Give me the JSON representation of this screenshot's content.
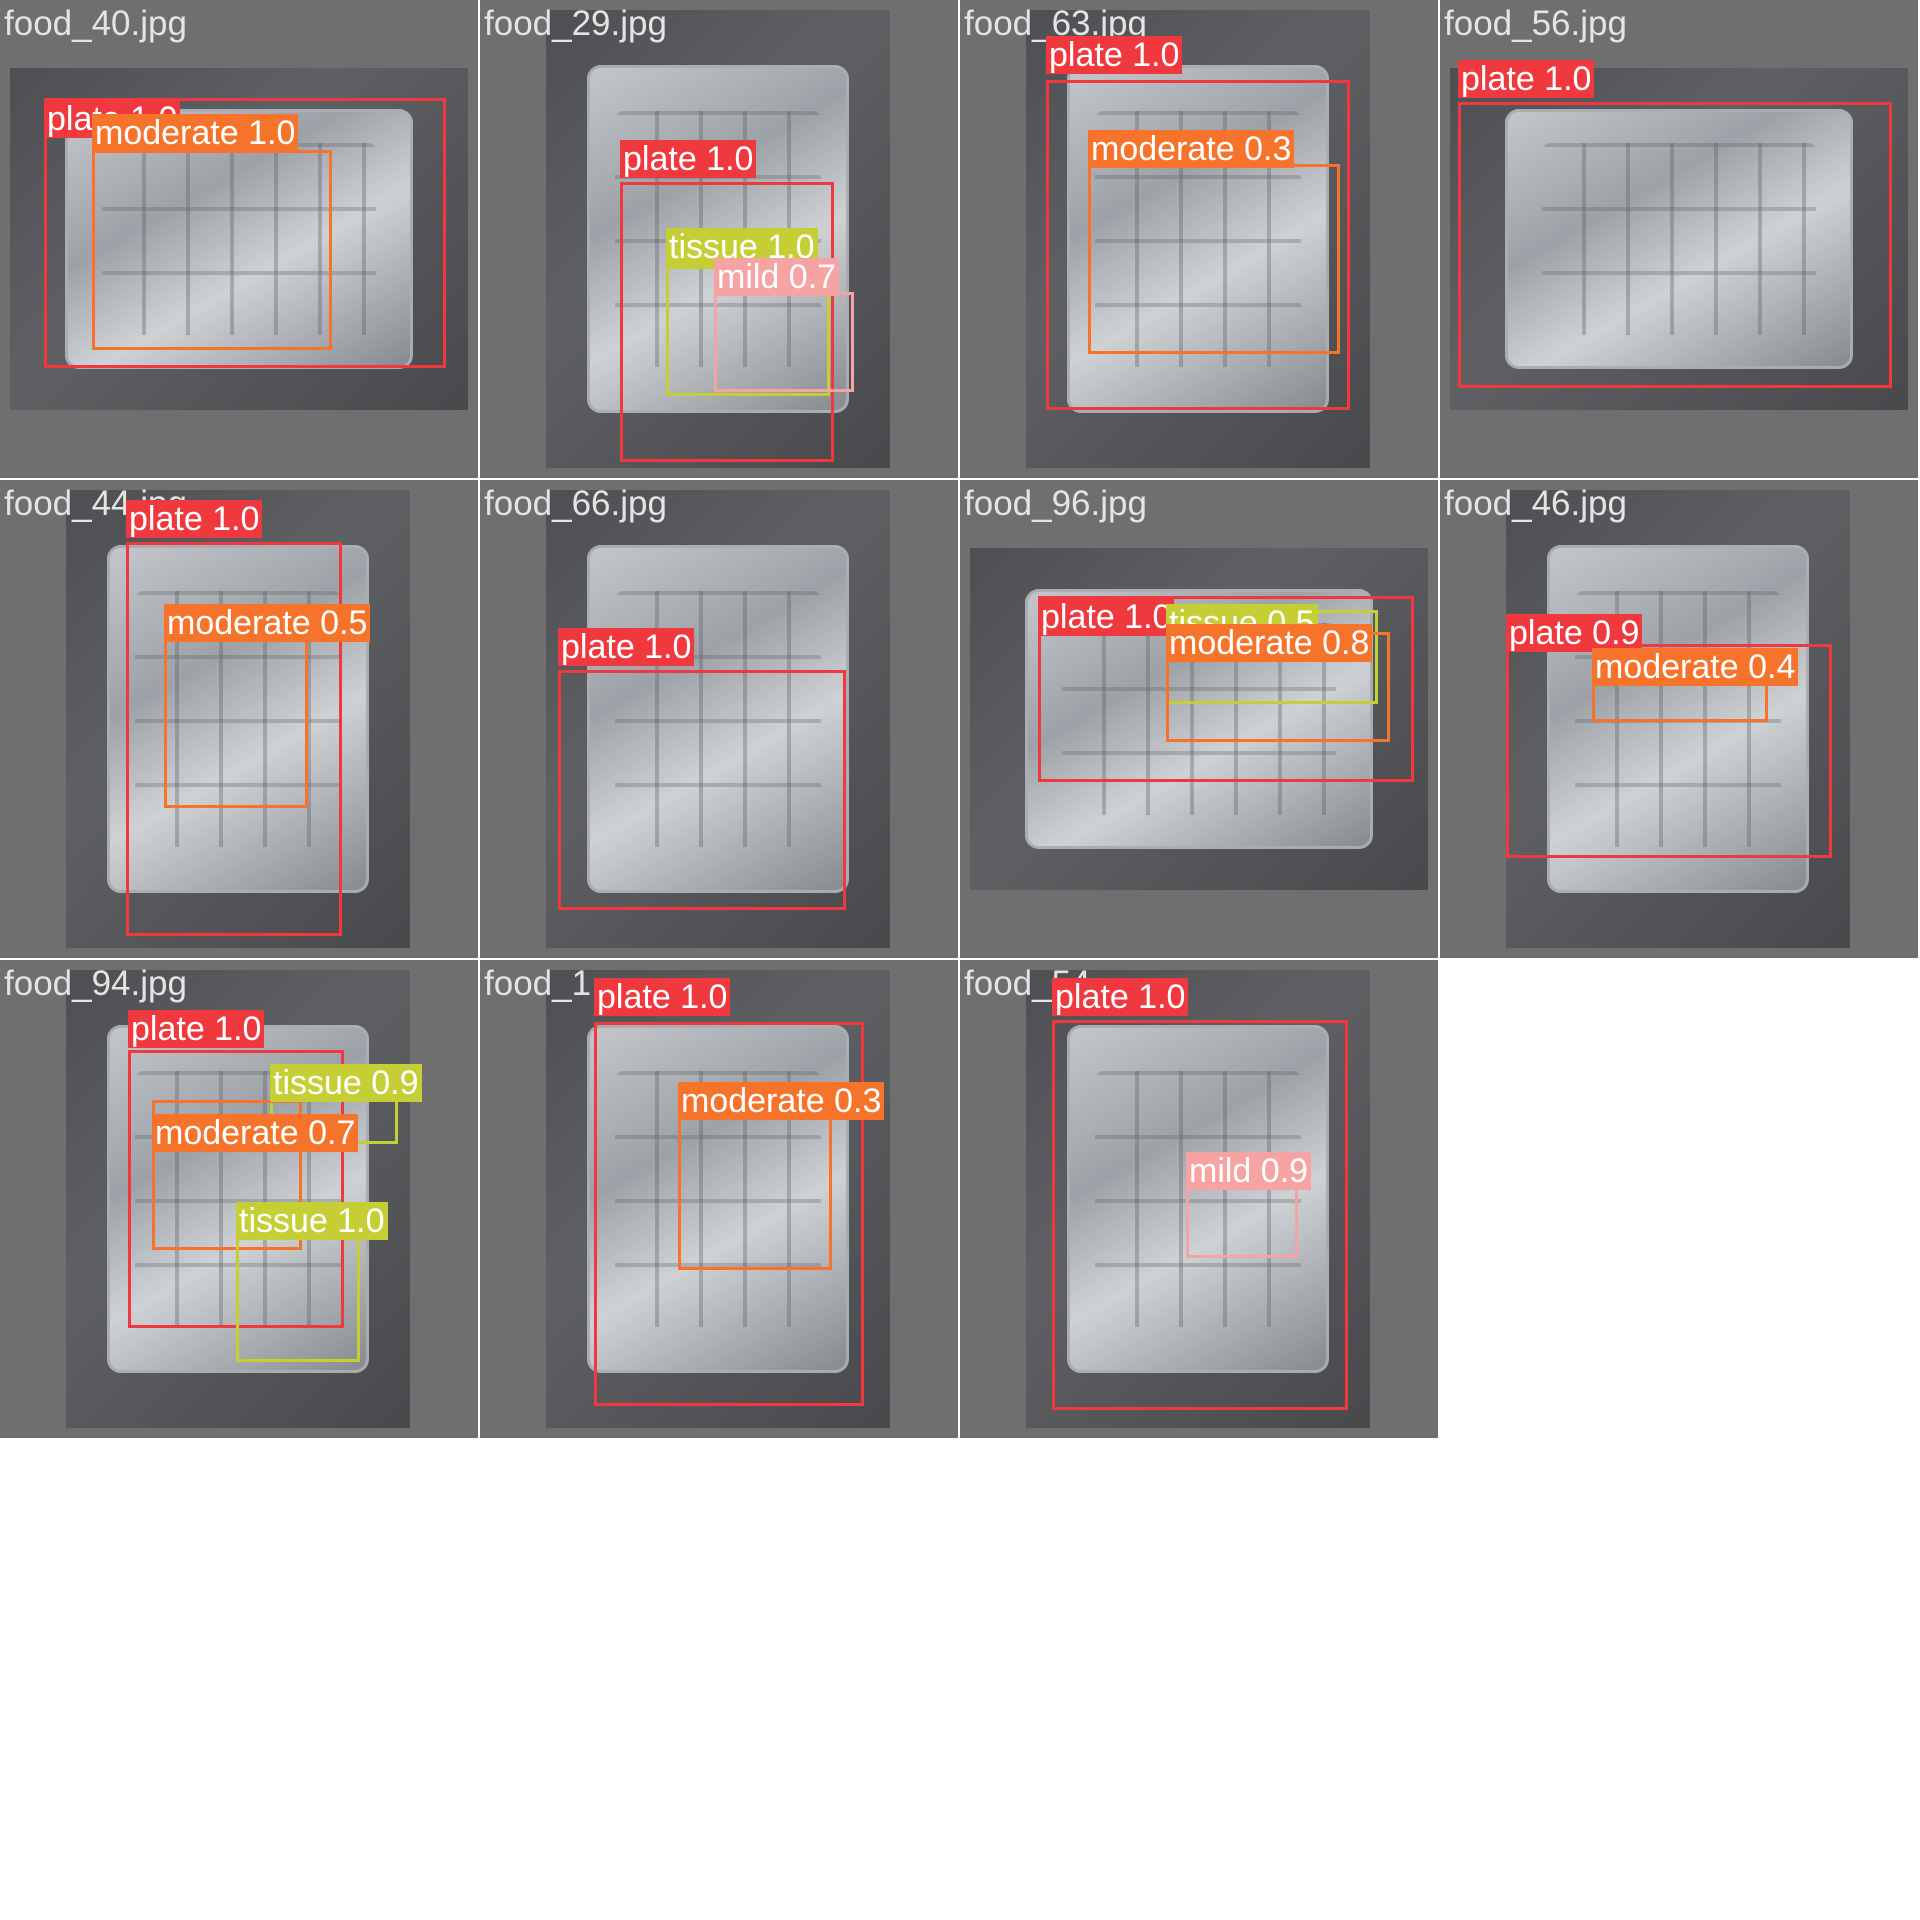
{
  "colors": {
    "plate": "#f0393e",
    "moderate": "#f5732a",
    "tissue": "#c5cf35",
    "mild": "#f5a3a3",
    "tile_background": "#6f6f6f"
  },
  "tiles": [
    {
      "filename": "food_40.jpg",
      "detections": [
        {
          "label": "plate 1.0",
          "class": "plate"
        },
        {
          "label": "moderate 1.0",
          "class": "moderate"
        }
      ]
    },
    {
      "filename": "food_29.jpg",
      "detections": [
        {
          "label": "plate 1.0",
          "class": "plate"
        },
        {
          "label": "tissue 1.0",
          "class": "tissue"
        },
        {
          "label": "mild 0.7",
          "class": "mild"
        }
      ]
    },
    {
      "filename": "food_63.jpg",
      "detections": [
        {
          "label": "plate 1.0",
          "class": "plate"
        },
        {
          "label": "moderate 0.3",
          "class": "moderate"
        }
      ]
    },
    {
      "filename": "food_56.jpg",
      "detections": [
        {
          "label": "plate 1.0",
          "class": "plate"
        }
      ]
    },
    {
      "filename": "food_44.jpg",
      "detections": [
        {
          "label": "plate 1.0",
          "class": "plate"
        },
        {
          "label": "moderate 0.5",
          "class": "moderate"
        }
      ]
    },
    {
      "filename": "food_66.jpg",
      "detections": [
        {
          "label": "plate 1.0",
          "class": "plate"
        }
      ]
    },
    {
      "filename": "food_96.jpg",
      "detections": [
        {
          "label": "plate 1.0",
          "class": "plate"
        },
        {
          "label": "tissue 0.5",
          "class": "tissue"
        },
        {
          "label": "moderate 0.8",
          "class": "moderate"
        }
      ]
    },
    {
      "filename": "food_46.jpg",
      "detections": [
        {
          "label": "plate 0.9",
          "class": "plate"
        },
        {
          "label": "moderate 0.4",
          "class": "moderate"
        }
      ]
    },
    {
      "filename": "food_94.jpg",
      "detections": [
        {
          "label": "plate 1.0",
          "class": "plate"
        },
        {
          "label": "tissue 0.9",
          "class": "tissue"
        },
        {
          "label": "moderate 0.7",
          "class": "moderate"
        },
        {
          "label": "tissue 1.0",
          "class": "tissue"
        }
      ]
    },
    {
      "filename": "food_1",
      "detections": [
        {
          "label": "plate 1.0",
          "class": "plate"
        },
        {
          "label": "moderate 0.3",
          "class": "moderate"
        }
      ]
    },
    {
      "filename": "food_54",
      "detections": [
        {
          "label": "plate 1.0",
          "class": "plate"
        },
        {
          "label": "mild 0.9",
          "class": "mild"
        }
      ]
    }
  ]
}
